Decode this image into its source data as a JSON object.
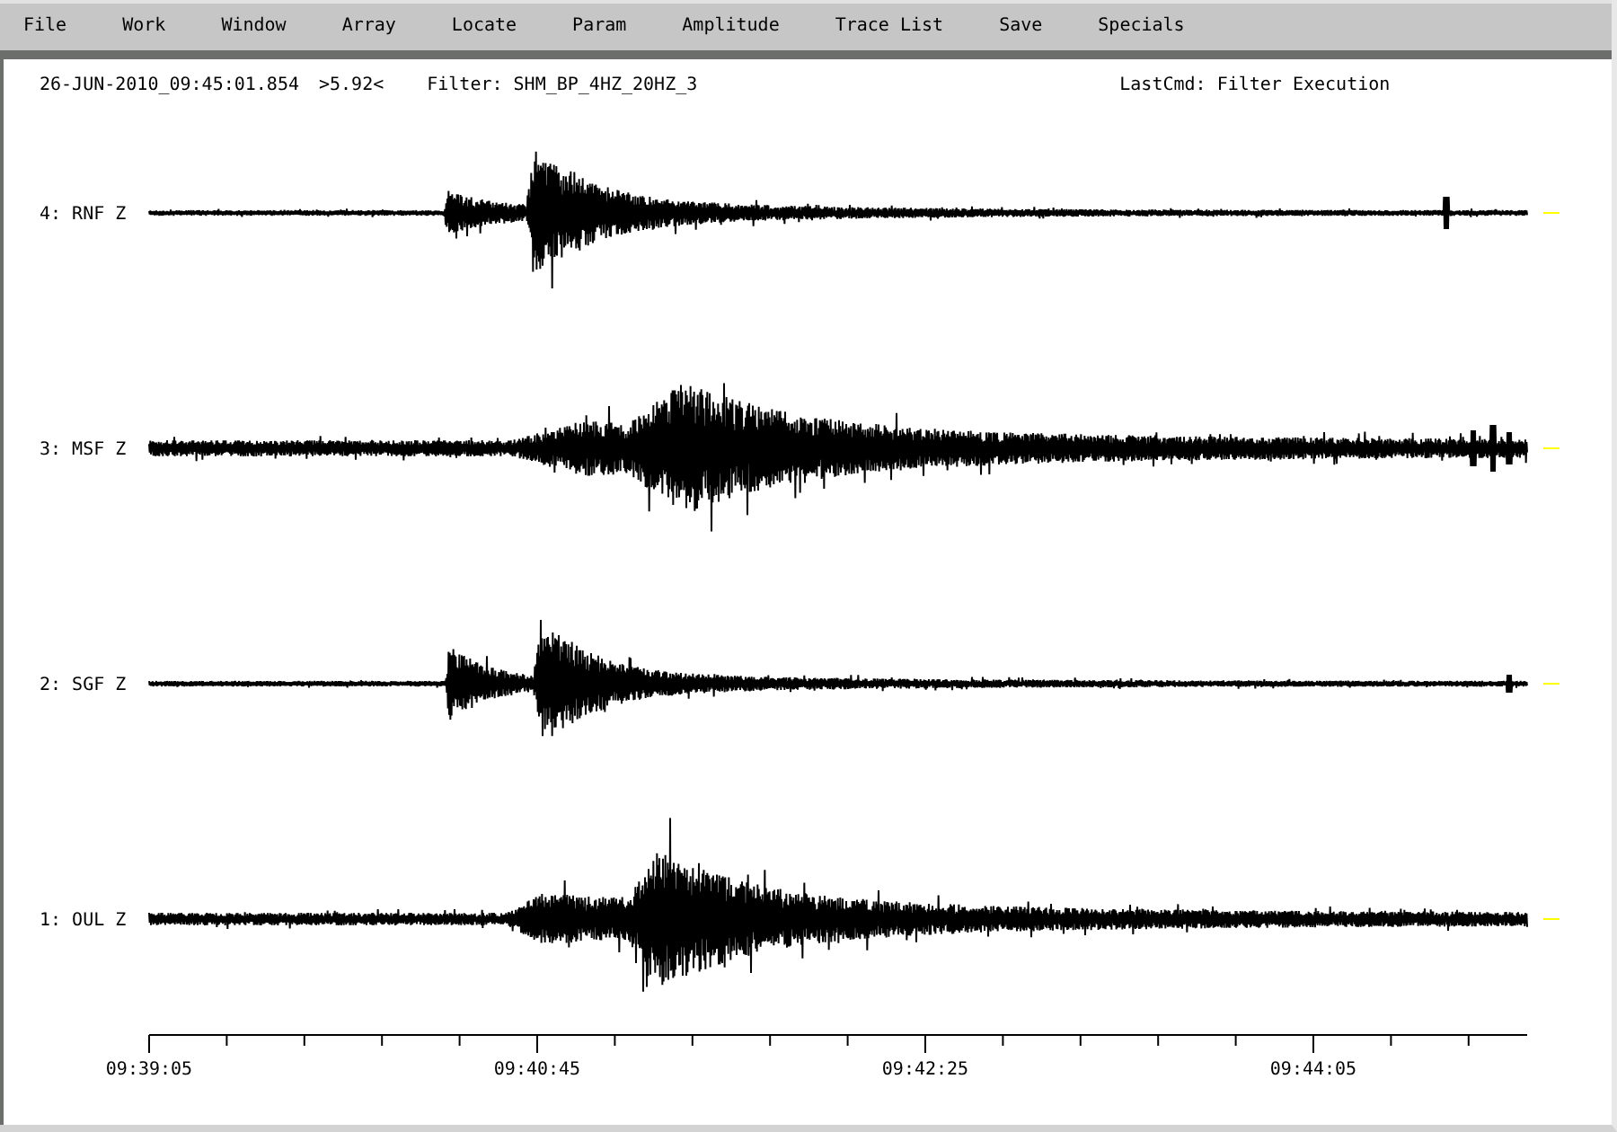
{
  "menu": [
    "File",
    "Work",
    "Window",
    "Array",
    "Locate",
    "Param",
    "Amplitude",
    "Trace List",
    "Save",
    "Specials"
  ],
  "status": {
    "timestamp": "26-JUN-2010_09:45:01.854",
    "amplitude": ">5.92<",
    "filter": "Filter: SHM_BP_4HZ_20HZ_3",
    "last_command": "LastCmd: Filter Execution"
  },
  "traces": [
    {
      "label": "4: RNF Z"
    },
    {
      "label": "3: MSF Z"
    },
    {
      "label": "2: SGF Z"
    },
    {
      "label": "1: OUL Z"
    }
  ],
  "time_axis": {
    "labels": [
      "09:39:05",
      "09:40:45",
      "09:42:25",
      "09:44:05"
    ]
  }
}
